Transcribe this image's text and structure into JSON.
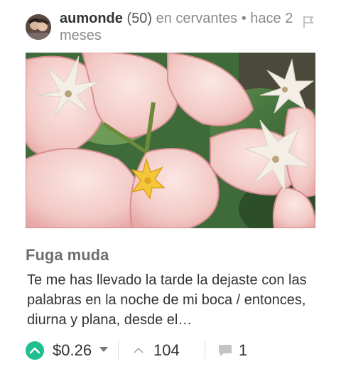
{
  "post": {
    "author": "aumonde",
    "reputation": "(50)",
    "community_prefix": "en",
    "community": "cervantes",
    "separator": "•",
    "time": "hace 2 meses",
    "title": "Fuga muda",
    "summary": "Te me has llevado la tarde la dejaste con las palabras en la noche de mi boca / entonces, diurna y plana, desde el…",
    "payout": "$0.26",
    "votes": "104",
    "comments": "1"
  },
  "colors": {
    "accent_green": "#1fbf8f",
    "text_dark": "#333333",
    "text_muted": "#8a8a8a",
    "title_gray": "#6f6f6f"
  },
  "icons": {
    "flag": "flag-icon",
    "upvote": "upvote-circle-icon",
    "dropdown": "caret-down-icon",
    "votes": "chevron-up-icon",
    "comments": "comment-bubble-icon"
  }
}
